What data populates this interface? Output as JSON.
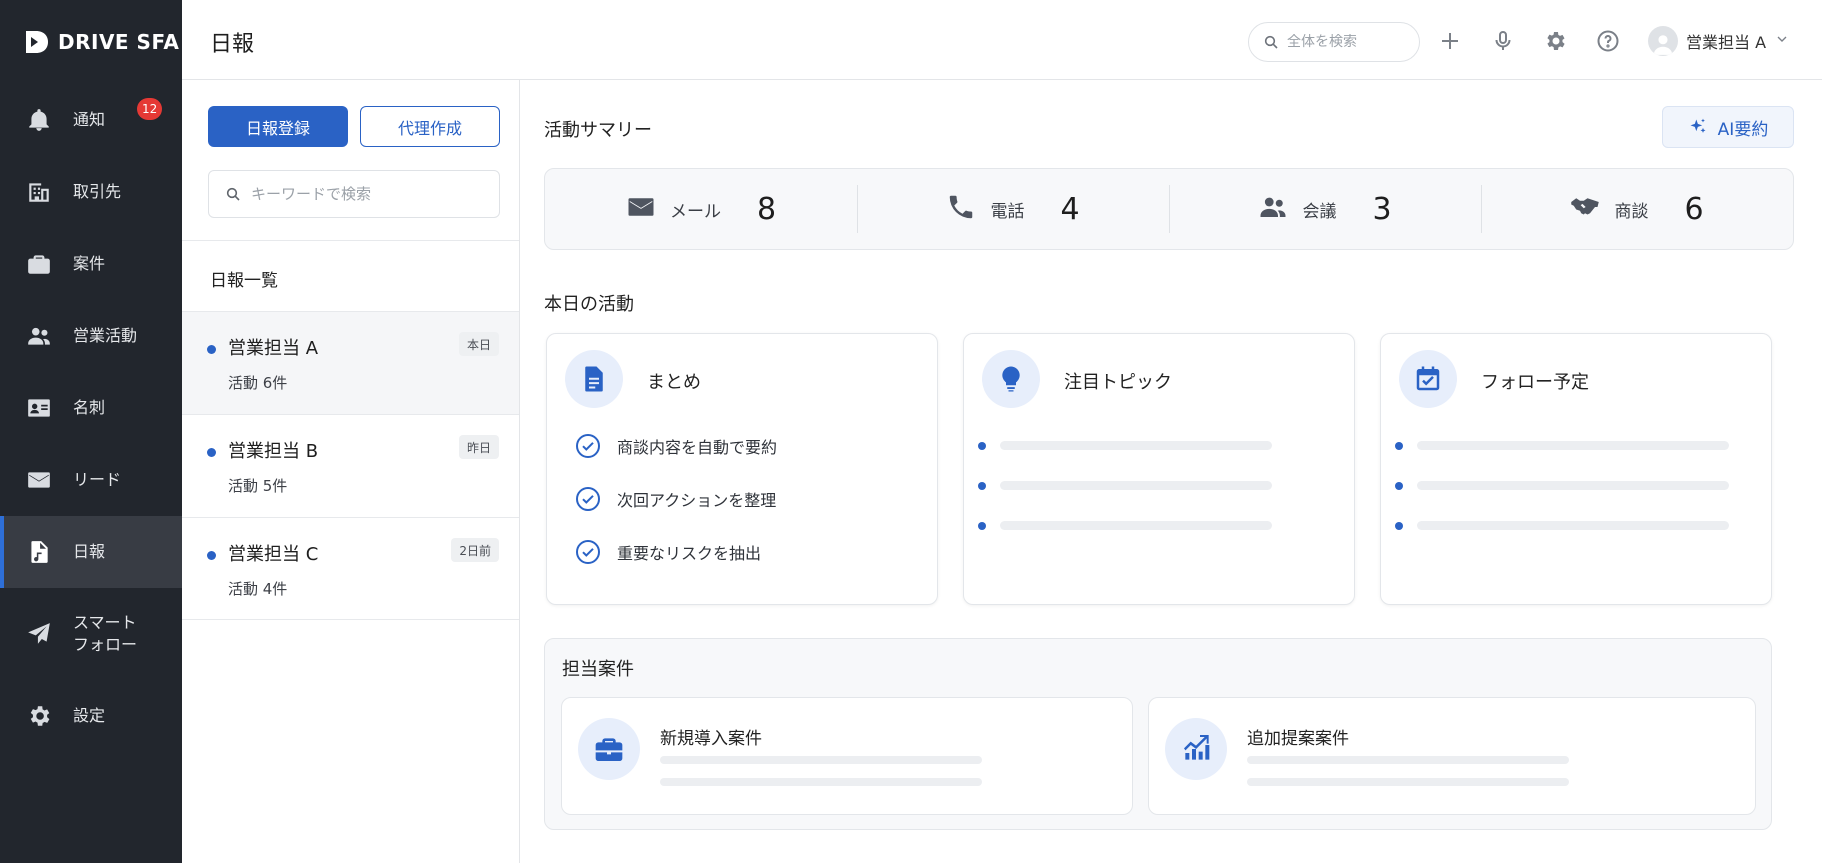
{
  "app": {
    "logo_text": "DRIVE SFA"
  },
  "sidebar": {
    "items": [
      {
        "label": "通知",
        "icon": "bell-icon",
        "badge": "12",
        "active": false
      },
      {
        "label": "取引先",
        "icon": "building-icon",
        "active": false
      },
      {
        "label": "案件",
        "icon": "briefcase-icon",
        "active": false
      },
      {
        "label": "営業活動",
        "icon": "people-icon",
        "active": false
      },
      {
        "label": "名刺",
        "icon": "contact-card-icon",
        "active": false
      },
      {
        "label": "リード",
        "icon": "mail-icon",
        "active": false
      },
      {
        "label": "日報",
        "icon": "daily-report-icon",
        "active": true
      },
      {
        "label": "スマート\nフォロー",
        "icon": "paper-plane-icon",
        "active": false
      },
      {
        "label": "設定",
        "icon": "gear-icon",
        "active": false
      }
    ]
  },
  "header": {
    "title": "日報",
    "search_placeholder": "全体を検索",
    "user_name": "営業担当 A"
  },
  "list_panel": {
    "primary_button": "日報登録",
    "secondary_button": "代理作成",
    "search_placeholder": "キーワードで検索",
    "heading": "日報一覧",
    "items": [
      {
        "name": "営業担当 A",
        "sub": "活動 6件",
        "tag": "本日",
        "selected": true
      },
      {
        "name": "営業担当 B",
        "sub": "活動 5件",
        "tag": "昨日",
        "selected": false
      },
      {
        "name": "営業担当 C",
        "sub": "活動 4件",
        "tag": "2日前",
        "selected": false
      }
    ]
  },
  "main": {
    "summary_title": "活動サマリー",
    "ai_button": "AI要約",
    "stats": [
      {
        "label": "メール",
        "value": "8",
        "icon": "mail-icon"
      },
      {
        "label": "電話",
        "value": "4",
        "icon": "phone-icon"
      },
      {
        "label": "会議",
        "value": "3",
        "icon": "people-icon"
      },
      {
        "label": "商談",
        "value": "6",
        "icon": "handshake-icon"
      }
    ],
    "today_title": "本日の活動",
    "cards": [
      {
        "title": "まとめ",
        "icon": "document-icon",
        "checks": [
          "商談内容を自動で要約",
          "次回アクションを整理",
          "重要なリスクを抽出"
        ]
      },
      {
        "title": "注目トピック",
        "icon": "lightbulb-icon"
      },
      {
        "title": "フォロー予定",
        "icon": "calendar-check-icon"
      }
    ],
    "cases_title": "担当案件",
    "cases": [
      {
        "title": "新規導入案件",
        "icon": "briefcase-icon"
      },
      {
        "title": "追加提案案件",
        "icon": "growth-chart-icon"
      }
    ]
  },
  "colors": {
    "accent": "#2a62c5",
    "sidebar_bg": "#22262d",
    "badge": "#e53935"
  }
}
